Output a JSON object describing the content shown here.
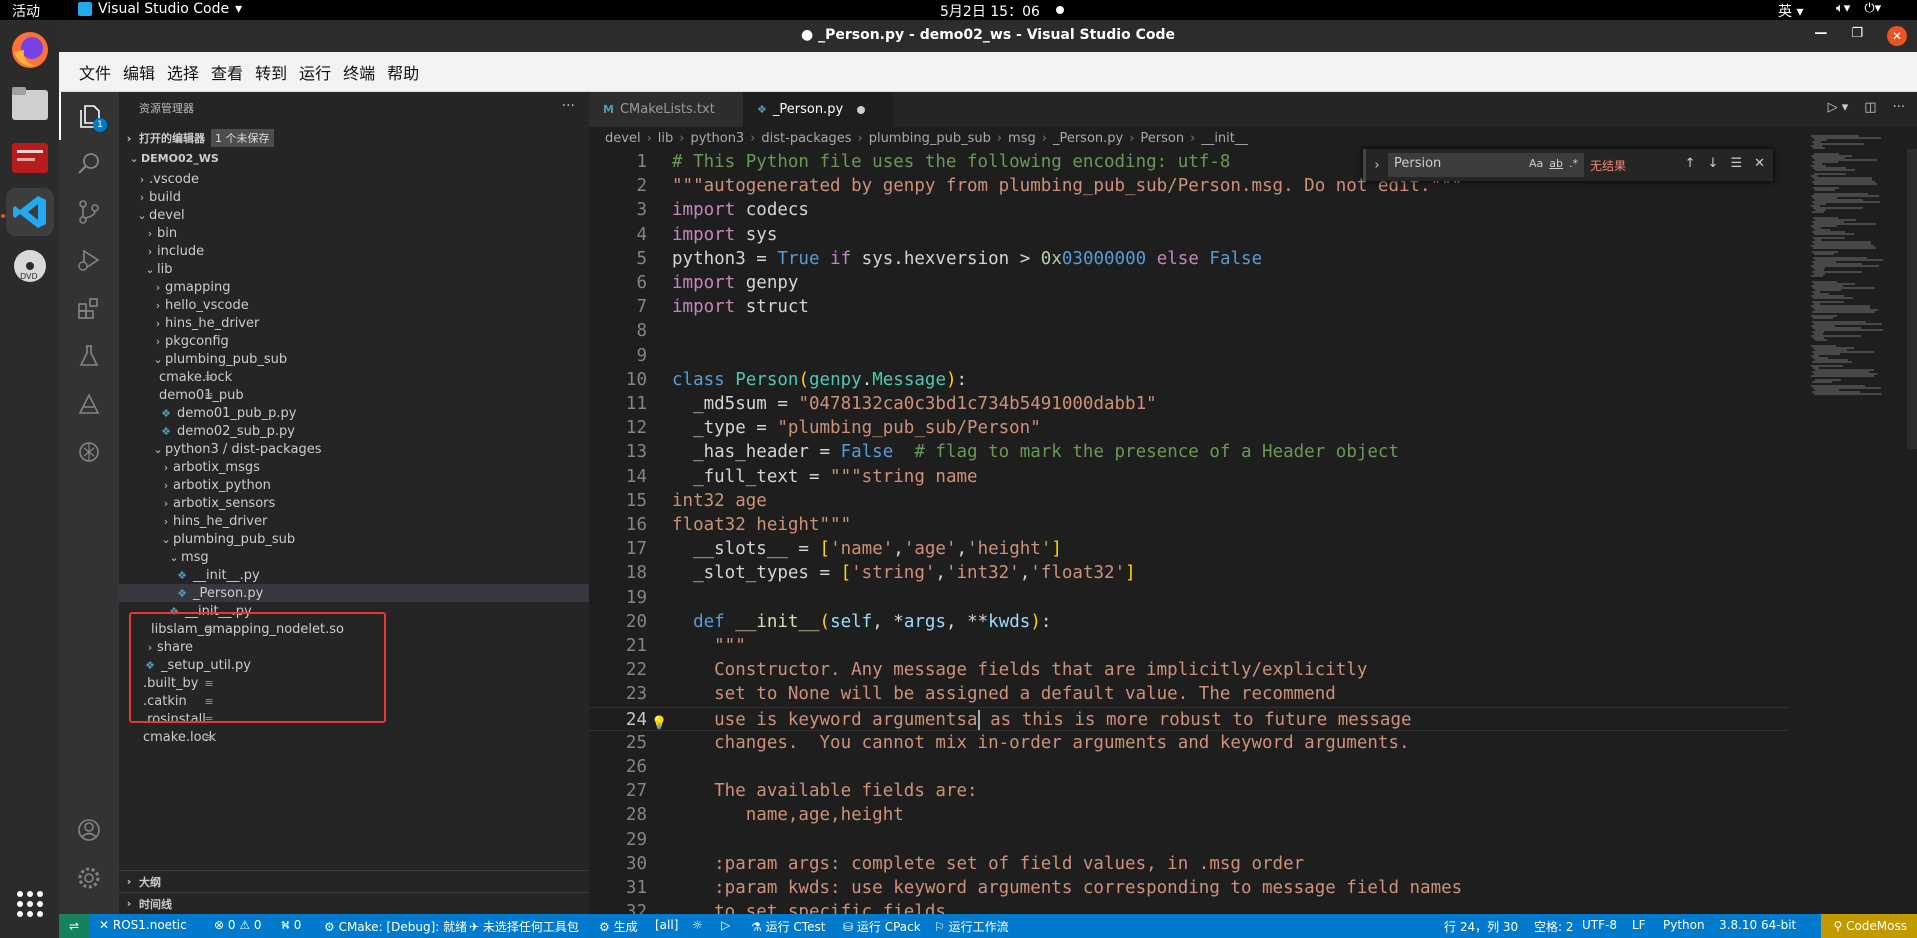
{
  "os_topbar": {
    "activities": "活动",
    "app_name": "Visual Studio Code",
    "clock": "5月2日  15：06",
    "ime": "英"
  },
  "window": {
    "title": "● _Person.py - demo02_ws - Visual Studio Code"
  },
  "menu": [
    "文件",
    "编辑",
    "选择",
    "查看",
    "转到",
    "运行",
    "终端",
    "帮助"
  ],
  "sidebar": {
    "header": "资源管理器",
    "open_editors": "打开的编辑器",
    "unsaved_tag": "1 个未保存",
    "explorer_badge": "1",
    "tree": [
      {
        "label": "DEMO02_WS",
        "depth": 0,
        "type": "root",
        "twisty": "open"
      },
      {
        "label": ".vscode",
        "depth": 1,
        "type": "folder",
        "twisty": "closed"
      },
      {
        "label": "build",
        "depth": 1,
        "type": "folder",
        "twisty": "closed"
      },
      {
        "label": "devel",
        "depth": 1,
        "type": "folder",
        "twisty": "open"
      },
      {
        "label": "bin",
        "depth": 2,
        "type": "folder",
        "twisty": "closed"
      },
      {
        "label": "include",
        "depth": 2,
        "type": "folder",
        "twisty": "closed"
      },
      {
        "label": "lib",
        "depth": 2,
        "type": "folder",
        "twisty": "open"
      },
      {
        "label": "gmapping",
        "depth": 3,
        "type": "folder",
        "twisty": "closed"
      },
      {
        "label": "hello_vscode",
        "depth": 3,
        "type": "folder",
        "twisty": "closed"
      },
      {
        "label": "hins_he_driver",
        "depth": 3,
        "type": "folder",
        "twisty": "closed"
      },
      {
        "label": "pkgconfig",
        "depth": 3,
        "type": "folder",
        "twisty": "closed"
      },
      {
        "label": "plumbing_pub_sub",
        "depth": 3,
        "type": "folder",
        "twisty": "open"
      },
      {
        "label": "cmake.lock",
        "depth": 4,
        "type": "txt"
      },
      {
        "label": "demo01_pub",
        "depth": 4,
        "type": "txt"
      },
      {
        "label": "demo01_pub_p.py",
        "depth": 4,
        "type": "py"
      },
      {
        "label": "demo02_sub_p.py",
        "depth": 4,
        "type": "py"
      },
      {
        "label": "python3 / dist-packages",
        "depth": 3,
        "type": "folder",
        "twisty": "open"
      },
      {
        "label": "arbotix_msgs",
        "depth": 4,
        "type": "folder",
        "twisty": "closed"
      },
      {
        "label": "arbotix_python",
        "depth": 4,
        "type": "folder",
        "twisty": "closed"
      },
      {
        "label": "arbotix_sensors",
        "depth": 4,
        "type": "folder",
        "twisty": "closed"
      },
      {
        "label": "hins_he_driver",
        "depth": 4,
        "type": "folder",
        "twisty": "closed"
      },
      {
        "label": "plumbing_pub_sub",
        "depth": 4,
        "type": "folder",
        "twisty": "open"
      },
      {
        "label": "msg",
        "depth": 5,
        "type": "folder",
        "twisty": "open"
      },
      {
        "label": "__init__.py",
        "depth": 6,
        "type": "py"
      },
      {
        "label": "_Person.py",
        "depth": 6,
        "type": "py",
        "selected": true
      },
      {
        "label": "__init__.py",
        "depth": 5,
        "type": "py"
      },
      {
        "label": "libslam_gmapping_nodelet.so",
        "depth": 3,
        "type": "txt"
      },
      {
        "label": "share",
        "depth": 2,
        "type": "folder",
        "twisty": "closed"
      },
      {
        "label": "_setup_util.py",
        "depth": 2,
        "type": "py"
      },
      {
        "label": ".built_by",
        "depth": 2,
        "type": "txt"
      },
      {
        "label": ".catkin",
        "depth": 2,
        "type": "txt"
      },
      {
        "label": ".rosinstall",
        "depth": 2,
        "type": "txt"
      },
      {
        "label": "cmake.lock",
        "depth": 2,
        "type": "txt"
      }
    ],
    "outline": "大纲",
    "timeline": "时间线"
  },
  "editor": {
    "tabs": [
      {
        "label": "CMakeLists.txt",
        "icon": "M",
        "active": false
      },
      {
        "label": "_Person.py",
        "icon": "py",
        "active": true,
        "dirty": true
      }
    ],
    "breadcrumb": [
      "devel",
      "lib",
      "python3",
      "dist-packages",
      "plumbing_pub_sub",
      "msg",
      "_Person.py",
      "Person",
      "__init__"
    ],
    "find": {
      "query": "Persion",
      "case_label": "Aa",
      "word_label": "ab",
      "regex_label": ".*",
      "result": "无结果"
    },
    "current_line": 24,
    "code": [
      [
        [
          "c",
          "# This Python file uses the following encoding: utf-8"
        ]
      ],
      [
        [
          "s",
          "\"\"\"autogenerated by genpy from plumbing_pub_sub/Person.msg. Do not edit.\"\"\""
        ]
      ],
      [
        [
          "kw",
          "import"
        ],
        [
          "w",
          " codecs"
        ]
      ],
      [
        [
          "kw",
          "import"
        ],
        [
          "w",
          " sys"
        ]
      ],
      [
        [
          "w",
          "python3 = "
        ],
        [
          "k",
          "True"
        ],
        [
          "w",
          " "
        ],
        [
          "kw",
          "if"
        ],
        [
          "w",
          " sys.hexversion > "
        ],
        [
          "n",
          "0x"
        ],
        [
          "k",
          "03000000"
        ],
        [
          "w",
          " "
        ],
        [
          "kw",
          "else"
        ],
        [
          "w",
          " "
        ],
        [
          "k",
          "False"
        ]
      ],
      [
        [
          "kw",
          "import"
        ],
        [
          "w",
          " genpy"
        ]
      ],
      [
        [
          "kw",
          "import"
        ],
        [
          "w",
          " struct"
        ]
      ],
      [],
      [],
      [
        [
          "k",
          "class"
        ],
        [
          "w",
          " "
        ],
        [
          "cls",
          "Person"
        ],
        [
          "p",
          "("
        ],
        [
          "cls",
          "genpy"
        ],
        [
          "w",
          "."
        ],
        [
          "cls",
          "Message"
        ],
        [
          "p",
          ")"
        ],
        [
          "w",
          ":"
        ]
      ],
      [
        [
          "w",
          "  _md5sum = "
        ],
        [
          "s",
          "\"0478132ca0c3bd1c734b5491000dabb1\""
        ]
      ],
      [
        [
          "w",
          "  _type = "
        ],
        [
          "s",
          "\"plumbing_pub_sub/Person\""
        ]
      ],
      [
        [
          "w",
          "  _has_header = "
        ],
        [
          "k",
          "False"
        ],
        [
          "w",
          "  "
        ],
        [
          "c",
          "# flag to mark the presence of a Header object"
        ]
      ],
      [
        [
          "w",
          "  _full_text = "
        ],
        [
          "s",
          "\"\"\"string name"
        ]
      ],
      [
        [
          "s",
          "int32 age"
        ]
      ],
      [
        [
          "s",
          "float32 height\"\"\""
        ]
      ],
      [
        [
          "w",
          "  __slots__ = "
        ],
        [
          "p",
          "["
        ],
        [
          "s",
          "'name'"
        ],
        [
          "w",
          ","
        ],
        [
          "s",
          "'age'"
        ],
        [
          "w",
          ","
        ],
        [
          "s",
          "'height'"
        ],
        [
          "p",
          "]"
        ]
      ],
      [
        [
          "w",
          "  _slot_types = "
        ],
        [
          "p",
          "["
        ],
        [
          "s",
          "'string'"
        ],
        [
          "w",
          ","
        ],
        [
          "s",
          "'int32'"
        ],
        [
          "w",
          ","
        ],
        [
          "s",
          "'float32'"
        ],
        [
          "p",
          "]"
        ]
      ],
      [],
      [
        [
          "w",
          "  "
        ],
        [
          "k",
          "def"
        ],
        [
          "w",
          " "
        ],
        [
          "fn",
          "__init__"
        ],
        [
          "p",
          "("
        ],
        [
          "v",
          "self"
        ],
        [
          "w",
          ", *"
        ],
        [
          "v",
          "args"
        ],
        [
          "w",
          ", **"
        ],
        [
          "v",
          "kwds"
        ],
        [
          "p",
          ")"
        ],
        [
          "w",
          ":"
        ]
      ],
      [
        [
          "s",
          "    \"\"\""
        ]
      ],
      [
        [
          "s",
          "    Constructor. Any message fields that are implicitly/explicitly"
        ]
      ],
      [
        [
          "s",
          "    set to None will be assigned a default value. The recommend"
        ]
      ],
      [
        [
          "s",
          "    use is keyword argumentsa"
        ],
        [
          "cursor",
          ""
        ],
        [
          "s",
          " as this is more robust to future message"
        ]
      ],
      [
        [
          "s",
          "    changes.  You cannot mix in-order arguments and keyword arguments."
        ]
      ],
      [],
      [
        [
          "s",
          "    The available fields are:"
        ]
      ],
      [
        [
          "s",
          "       name,age,height"
        ]
      ],
      [],
      [
        [
          "s",
          "    :param args: complete set of field values, in .msg order"
        ]
      ],
      [
        [
          "s",
          "    :param kwds: use keyword arguments corresponding to message field names"
        ]
      ],
      [
        [
          "s",
          "    to set specific fields."
        ]
      ]
    ]
  },
  "statusbar": {
    "remote_icon": "remote-icon",
    "ros": "ROS1.noetic",
    "problems": "⊗ 0 ⚠ 0",
    "ports": "⛕ 0",
    "cmake": "CMake: [Debug]: 就绪",
    "kit": "未选择任何工具包",
    "build": "生成",
    "target": "[all]",
    "ctest": "运行 CTest",
    "cpack": "运行 CPack",
    "workflow": "运行工作流",
    "position": "行 24，列 30",
    "spaces": "空格: 2",
    "encoding": "UTF-8",
    "eol": "LF",
    "language": "Python",
    "interpreter": "3.8.10 64-bit",
    "codemoss": "CodeMoss"
  }
}
